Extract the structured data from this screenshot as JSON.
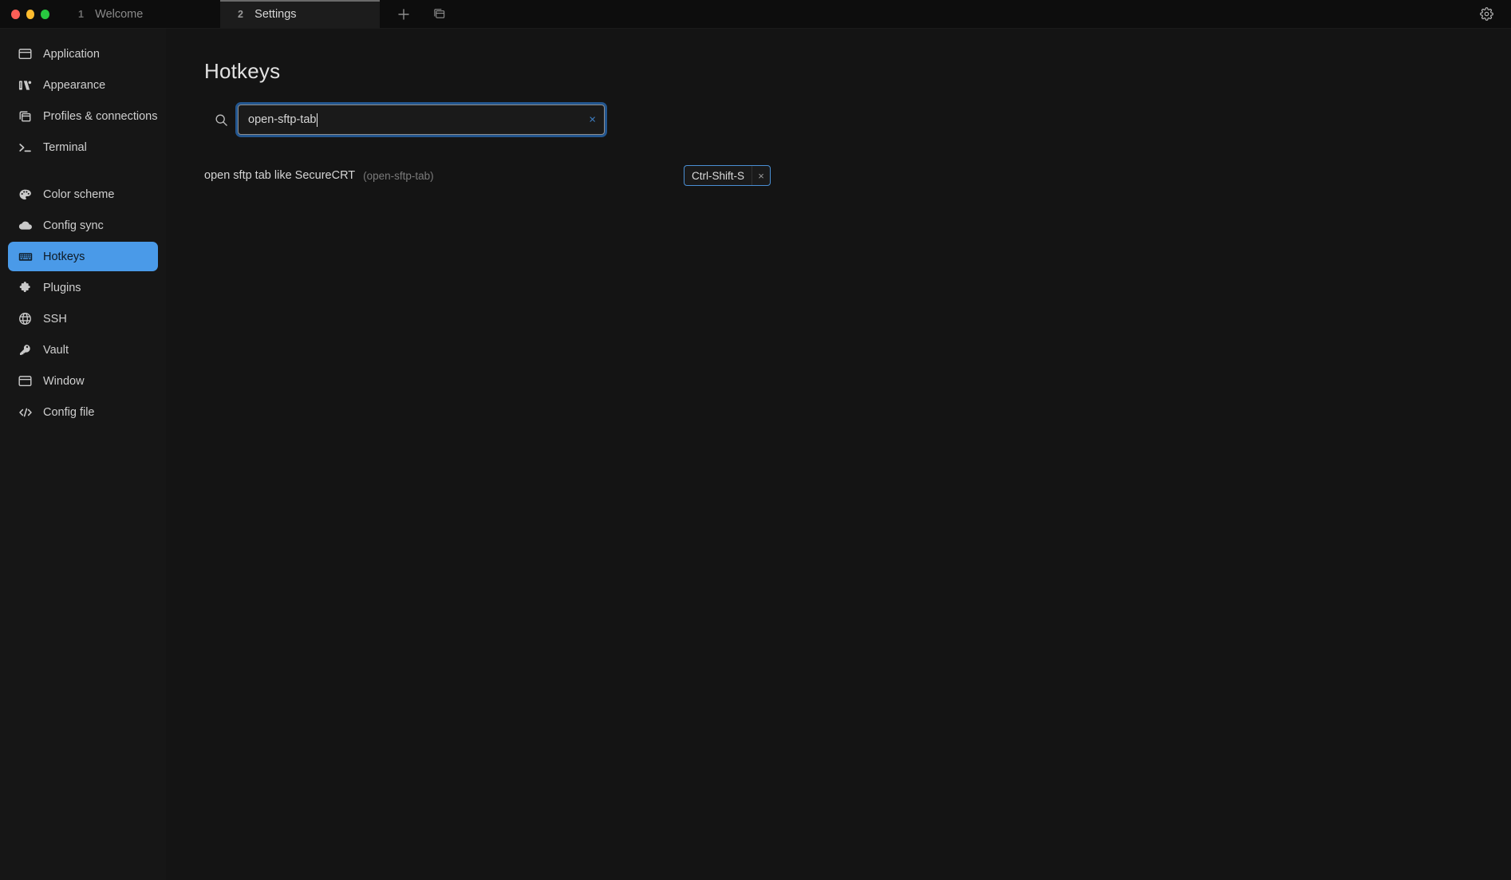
{
  "window": {
    "controls": {
      "close": "close",
      "minimize": "minimize",
      "maximize": "maximize"
    },
    "settings_icon": "gear-icon"
  },
  "tabbar": {
    "tabs": [
      {
        "index": "1",
        "label": "Welcome",
        "active": false
      },
      {
        "index": "2",
        "label": "Settings",
        "active": true
      }
    ],
    "new_tab_label": "+",
    "new_tab_icon": "plus-icon",
    "split_icon": "windows-stack-icon"
  },
  "sidebar": {
    "groups": [
      {
        "items": [
          {
            "label": "Application",
            "icon": "window-icon",
            "active": false
          },
          {
            "label": "Appearance",
            "icon": "palette-sliders-icon",
            "active": false
          },
          {
            "label": "Profiles & connections",
            "icon": "copy-stack-icon",
            "active": false
          },
          {
            "label": "Terminal",
            "icon": "terminal-prompt-icon",
            "active": false
          }
        ]
      },
      {
        "items": [
          {
            "label": "Color scheme",
            "icon": "palette-icon",
            "active": false
          },
          {
            "label": "Config sync",
            "icon": "cloud-icon",
            "active": false
          },
          {
            "label": "Hotkeys",
            "icon": "keyboard-icon",
            "active": true
          },
          {
            "label": "Plugins",
            "icon": "puzzle-icon",
            "active": false
          },
          {
            "label": "SSH",
            "icon": "globe-icon",
            "active": false
          },
          {
            "label": "Vault",
            "icon": "key-icon",
            "active": false
          },
          {
            "label": "Window",
            "icon": "window-icon",
            "active": false
          },
          {
            "label": "Config file",
            "icon": "code-icon",
            "active": false
          }
        ]
      }
    ]
  },
  "main": {
    "title": "Hotkeys",
    "search": {
      "icon": "search-icon",
      "value": "open-sftp-tab",
      "placeholder": "",
      "clear_label": "×",
      "clear_icon": "clear-icon"
    },
    "hotkeys": [
      {
        "name": "open sftp tab like SecureCRT",
        "id": "(open-sftp-tab)",
        "chips": [
          {
            "label": "Ctrl-Shift-S",
            "remove_label": "×"
          }
        ]
      }
    ]
  },
  "colors": {
    "accent_blue": "#4a9ae8",
    "chip_border": "#4a8fd4",
    "focus_ring": "#2661a5",
    "background": "#141414",
    "sidebar_bg": "#161616",
    "titlebar_bg": "#0d0d0d",
    "active_tab_bg": "#1c1c1c"
  }
}
